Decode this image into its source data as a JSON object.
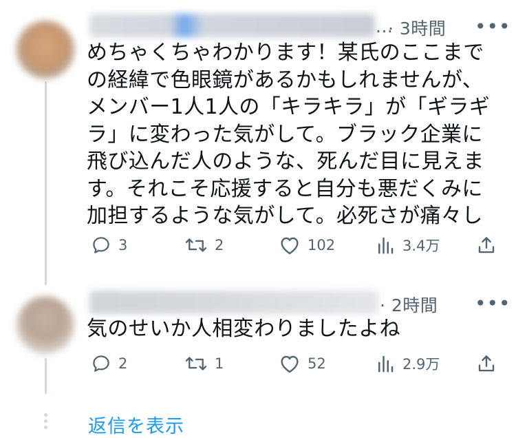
{
  "replies": [
    {
      "time": "· 3時間",
      "ellipsis": "...",
      "text": "めちゃくちゃわかります！某氏のここまでの経緯で色眼鏡があるかもしれませんが、メンバー1人1人の「キラキラ」が「ギラギラ」に変わった気がして。ブラック企業に飛び込んだ人のような、死んだ目に見えます。それこそ応援すると自分も悪だくみに加担するような気がして。必死さが痛々しいです。",
      "reply_count": "3",
      "repost_count": "2",
      "like_count": "102",
      "view_count": "3.4万"
    },
    {
      "time": "· 2時間",
      "text": "気のせいか人相変わりましたよね",
      "reply_count": "2",
      "repost_count": "1",
      "like_count": "52",
      "view_count": "2.9万"
    }
  ],
  "more_label": "•••",
  "show_replies_label": "返信を表示",
  "colors": {
    "text": "#0f1419",
    "secondary": "#536471",
    "link": "#1d9bf0",
    "thread_line": "#cfd9de"
  },
  "icons": [
    "reply-icon",
    "repost-icon",
    "like-icon",
    "views-icon",
    "share-icon",
    "more-icon"
  ]
}
